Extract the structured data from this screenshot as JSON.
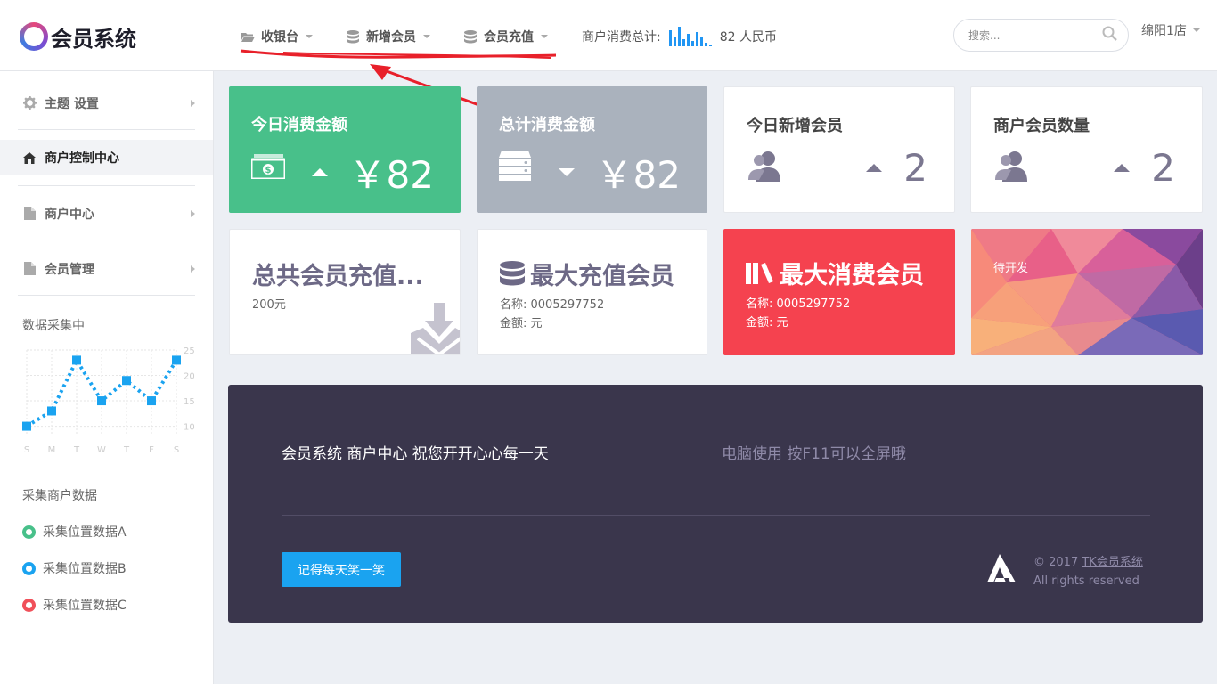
{
  "header": {
    "logo_text": "会员系统",
    "nav": [
      {
        "label": "收银台",
        "icon": "folder-open-icon"
      },
      {
        "label": "新增会员",
        "icon": "database-icon"
      },
      {
        "label": "会员充值",
        "icon": "database-icon"
      }
    ],
    "stat_label": "商户消费总计:",
    "stat_value": "82 人民币",
    "search_placeholder": "搜索...",
    "user_label": "绵阳1店"
  },
  "sidebar": {
    "items": [
      {
        "label": "主题 设置",
        "icon": "gear-icon"
      },
      {
        "label": "商户控制中心",
        "icon": "home-icon",
        "active": true
      },
      {
        "label": "商户中心",
        "icon": "file-icon"
      },
      {
        "label": "会员管理",
        "icon": "file-icon"
      }
    ],
    "chart_heading": "数据采集中",
    "collect_heading": "采集商户数据",
    "legend": [
      {
        "label": "采集位置数据A",
        "color": "#48c08a"
      },
      {
        "label": "采集位置数据B",
        "color": "#1aa3f0"
      },
      {
        "label": "采集位置数据C",
        "color": "#f0505a"
      }
    ]
  },
  "chart_data": {
    "type": "line",
    "categories": [
      "S",
      "M",
      "T",
      "W",
      "T",
      "F",
      "S",
      "S"
    ],
    "x_positions": [
      0,
      1,
      2,
      3,
      4,
      5,
      6
    ],
    "values": [
      10,
      13,
      23,
      15,
      19,
      15,
      23
    ],
    "yticks": [
      "25",
      "20",
      "15",
      "10"
    ],
    "xticks": [
      "S",
      "M",
      "T",
      "W",
      "T",
      "F",
      "S"
    ],
    "ylim": [
      8,
      25
    ],
    "color": "#1aa3f0",
    "grid": true
  },
  "cards": {
    "today_spend": {
      "title": "今日消费金额",
      "value": "￥82",
      "icon": "money-icon",
      "color": "#48c08a"
    },
    "total_spend": {
      "title": "总计消费金额",
      "value": "￥82",
      "icon": "server-icon",
      "color": "#aab2bd"
    },
    "today_members": {
      "title": "今日新增会员",
      "value": "2",
      "icon": "users-icon"
    },
    "member_count": {
      "title": "商户会员数量",
      "value": "2",
      "icon": "users-icon"
    },
    "total_recharge": {
      "title": "总共会员充值...",
      "value": "200元",
      "icon": "download-icon"
    },
    "max_recharge": {
      "title": "最大充值会员",
      "name_line": "名称: 0005297752",
      "amount_line": "金额: 元",
      "icon": "database-icon"
    },
    "max_spend": {
      "title": "最大消费会员",
      "name_line": "名称: 0005297752",
      "amount_line": "金额: 元",
      "icon": "books-icon",
      "color": "#f5424f"
    },
    "pending": {
      "title": "待开发"
    }
  },
  "footer": {
    "left_text": "会员系统 商户中心 祝您开开心心每一天",
    "right_text": "电脑使用 按F11可以全屏哦",
    "button_label": "记得每天笑一笑",
    "copyright_prefix": "© 2017 ",
    "copyright_link": "TK会员系统",
    "rights": "All rights reserved"
  }
}
